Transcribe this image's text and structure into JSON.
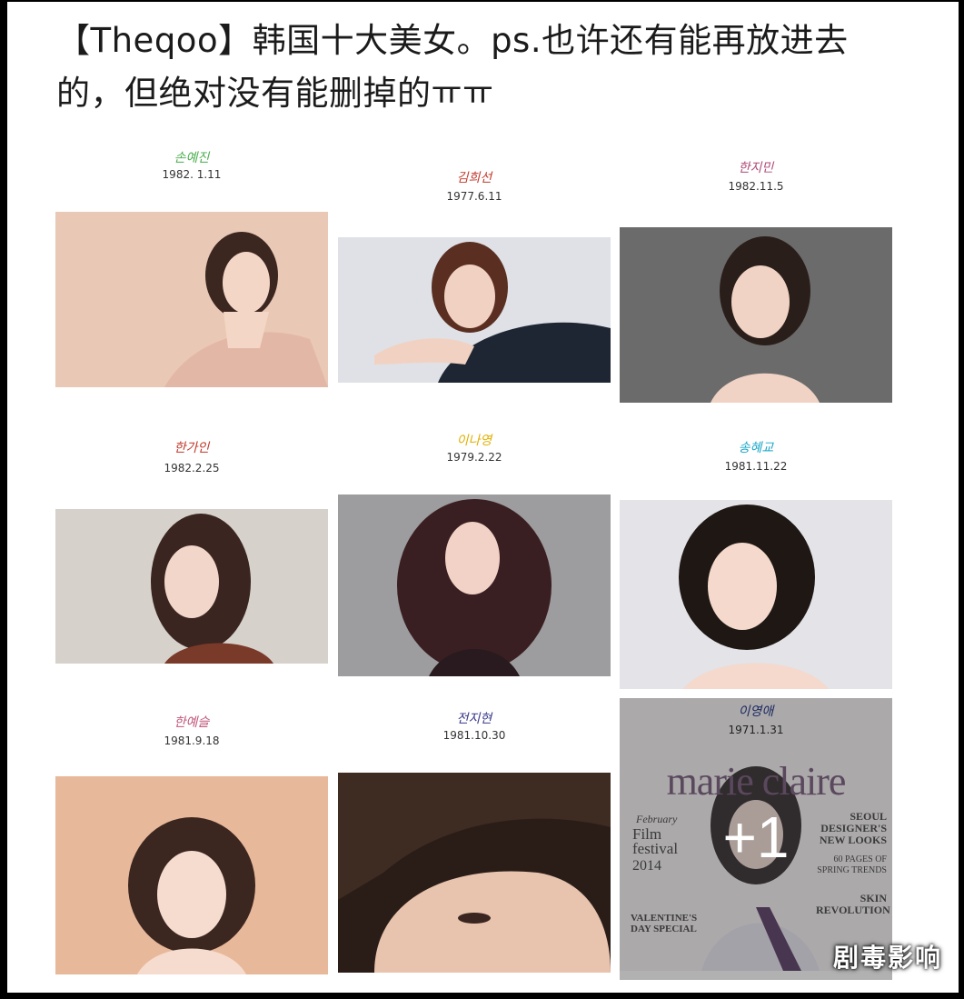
{
  "post": {
    "title": "【Theqoo】韩国十大美女。ps.也许还有能再放进去的，但绝对没有能删掉的ㅠㅠ"
  },
  "gallery": [
    {
      "name": "손예진",
      "date": "1982. 1.11",
      "name_color": "#4caf50"
    },
    {
      "name": "김희선",
      "date": "1977.6.11",
      "name_color": "#c0392b"
    },
    {
      "name": "한지민",
      "date": "1982.11.5",
      "name_color": "#b04a7a"
    },
    {
      "name": "한가인",
      "date": "1982.2.25",
      "name_color": "#c0392b"
    },
    {
      "name": "이나영",
      "date": "1979.2.22",
      "name_color": "#e0b000"
    },
    {
      "name": "송혜교",
      "date": "1981.11.22",
      "name_color": "#1aa6c8"
    },
    {
      "name": "한예슬",
      "date": "1981.9.18",
      "name_color": "#c0577a"
    },
    {
      "name": "전지현",
      "date": "1981.10.30",
      "name_color": "#3a3a8a"
    },
    {
      "name": "이영애",
      "date": "1971.1.31",
      "name_color": "#2c3e80"
    }
  ],
  "last_card": {
    "more_count": "+1",
    "magazine": {
      "logo": "marie claire",
      "line1": "February",
      "line2": "Film festival",
      "line3": "2014",
      "line4": "SEOUL DESIGNER'S NEW LOOKS",
      "line5": "60 PAGES OF SPRING TRENDS",
      "line6": "SKIN REVOLUTION",
      "line7": "VALENTINE'S DAY SPECIAL"
    }
  },
  "watermark": "剧毒影响"
}
